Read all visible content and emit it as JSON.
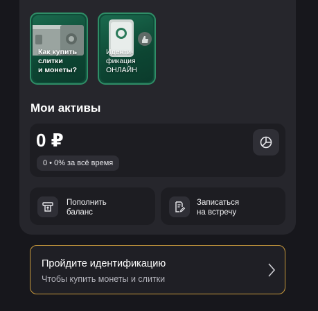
{
  "stories": [
    {
      "label": "Как купить\nслитки\nи монеты?"
    },
    {
      "label": "Иденти-\nфикация\nОНЛАЙН"
    }
  ],
  "assets": {
    "title": "Мои активы",
    "balance": "0 ₽",
    "change": "0 • 0% за всё время"
  },
  "actions": {
    "topup_label": "Пополнить\nбаланс",
    "meeting_label": "Записаться\nна встречу"
  },
  "identification": {
    "title": "Пройдите идентификацию",
    "subtitle": "Чтобы купить монеты и слитки"
  },
  "colors": {
    "background": "#17171c",
    "panel": "#26262c",
    "card": "#1d1d22",
    "story_green": "#0f4b38",
    "accent_gold": "#c99a3c"
  },
  "icons": {
    "analytics": "pie-chart-icon",
    "topup": "wallet-topup-icon",
    "meeting": "document-pen-icon",
    "chevron": "chevron-right-icon"
  }
}
